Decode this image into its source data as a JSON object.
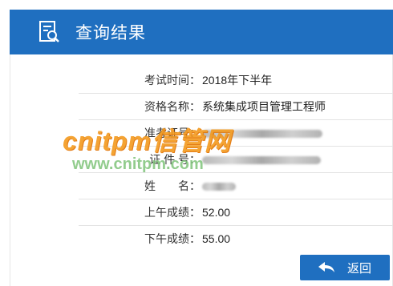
{
  "header": {
    "title": "查询结果",
    "icon": "search-document-icon"
  },
  "colors": {
    "brand": "#1f6fc0",
    "watermark_orange": "#f39a1e",
    "watermark_green": "#7fc47a"
  },
  "results": {
    "exam_time": {
      "label": "考试时间：",
      "value": "2018年下半年"
    },
    "qualification": {
      "label": "资格名称：",
      "value": "系统集成项目管理工程师"
    },
    "admission_no": {
      "label": "准考证号：",
      "value": ""
    },
    "id_no": {
      "label": "证 件 号：",
      "value": ""
    },
    "name": {
      "label": "姓　　名：",
      "value": ""
    },
    "morning_score": {
      "label": "上午成绩：",
      "value": "52.00"
    },
    "afternoon_score": {
      "label": "下午成绩：",
      "value": "55.00"
    }
  },
  "watermark": {
    "line1": "cnitpm信管网",
    "line2": "www.cnitpm.com"
  },
  "back_button": {
    "label": "返回",
    "icon": "back-arrow-icon"
  }
}
